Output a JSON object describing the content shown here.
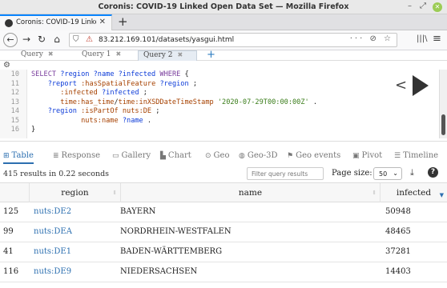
{
  "window": {
    "title": "Coronis: COVID-19 Linked Open Data Set — Mozilla Firefox"
  },
  "browser": {
    "tab_title": "Coronis: COVID-19 Linked Ope",
    "url": "83.212.169.101/datasets/yasgui.html",
    "url_right": "··· ⊘ ☆"
  },
  "query_tabs": [
    {
      "label": "Query",
      "close": "✖"
    },
    {
      "label": "Query 1",
      "close": "✖"
    },
    {
      "label": "Query 2",
      "close": "✖"
    }
  ],
  "editor": {
    "line_numbers": [
      "10",
      "11",
      "12",
      "13",
      "14",
      "15",
      "16"
    ]
  },
  "result_tabs": [
    {
      "label": "Table"
    },
    {
      "label": "Response"
    },
    {
      "label": "Gallery"
    },
    {
      "label": "Chart"
    },
    {
      "label": "Geo"
    },
    {
      "label": "Geo-3D"
    },
    {
      "label": "Geo events"
    },
    {
      "label": "Pivot"
    },
    {
      "label": "Timeline"
    }
  ],
  "results": {
    "info": "415 results in 0.22 seconds",
    "filter_placeholder": "Filter query results",
    "page_size_label": "Page size:",
    "page_size_value": "50"
  },
  "table": {
    "columns": [
      "region",
      "name",
      "infected"
    ],
    "rows": [
      {
        "idx": "125",
        "region": "nuts:DE2",
        "name": "BAYERN",
        "infected": "50948"
      },
      {
        "idx": "99",
        "region": "nuts:DEA",
        "name": "NORDRHEIN-WESTFALEN",
        "infected": "48465"
      },
      {
        "idx": "41",
        "region": "nuts:DE1",
        "name": "BADEN-WÄRTTEMBERG",
        "infected": "37281"
      },
      {
        "idx": "116",
        "region": "nuts:DE9",
        "name": "NIEDERSACHSEN",
        "infected": "14403"
      }
    ]
  }
}
